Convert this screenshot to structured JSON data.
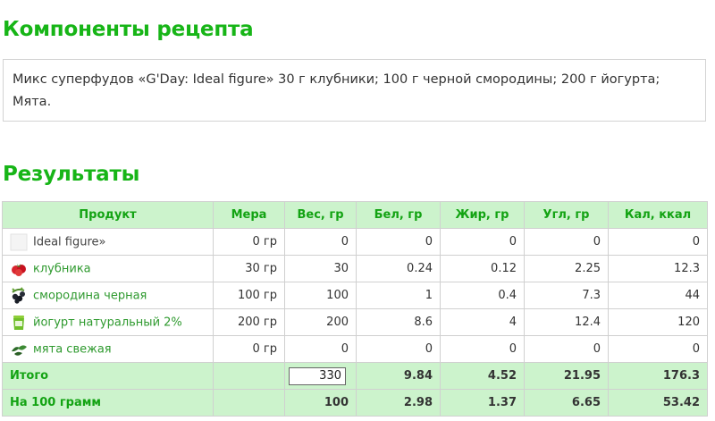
{
  "title_components": "Компоненты рецепта",
  "recipe_text": "Микс суперфудов «G'Day: Ideal figure» 30 г клубники; 100 г черной смородины; 200 г йогурта; Мята.",
  "title_results": "Результаты",
  "table": {
    "headers": [
      "Продукт",
      "Мера",
      "Вес, гр",
      "Бел, гр",
      "Жир, гр",
      "Угл, гр",
      "Кал, ккал"
    ],
    "rows": [
      {
        "name": "Ideal figure»",
        "icon": "blank-product-icon",
        "measure": "0 гр",
        "weight": "0",
        "protein": "0",
        "fat": "0",
        "carbs": "0",
        "kcal": "0"
      },
      {
        "name": "клубника",
        "icon": "strawberry-icon",
        "measure": "30 гр",
        "weight": "30",
        "protein": "0.24",
        "fat": "0.12",
        "carbs": "2.25",
        "kcal": "12.3"
      },
      {
        "name": "смородина черная",
        "icon": "blackcurrant-icon",
        "measure": "100 гр",
        "weight": "100",
        "protein": "1",
        "fat": "0.4",
        "carbs": "7.3",
        "kcal": "44"
      },
      {
        "name": "йогурт натуральный 2%",
        "icon": "yogurt-icon",
        "measure": "200 гр",
        "weight": "200",
        "protein": "8.6",
        "fat": "4",
        "carbs": "12.4",
        "kcal": "120"
      },
      {
        "name": "мята свежая",
        "icon": "mint-icon",
        "measure": "0 гр",
        "weight": "0",
        "protein": "0",
        "fat": "0",
        "carbs": "0",
        "kcal": "0"
      }
    ],
    "total": {
      "label": "Итого",
      "weight": "330",
      "protein": "9.84",
      "fat": "4.52",
      "carbs": "21.95",
      "kcal": "176.3"
    },
    "per100": {
      "label": "На 100 грамм",
      "weight": "100",
      "protein": "2.98",
      "fat": "1.37",
      "carbs": "6.65",
      "kcal": "53.42"
    }
  }
}
